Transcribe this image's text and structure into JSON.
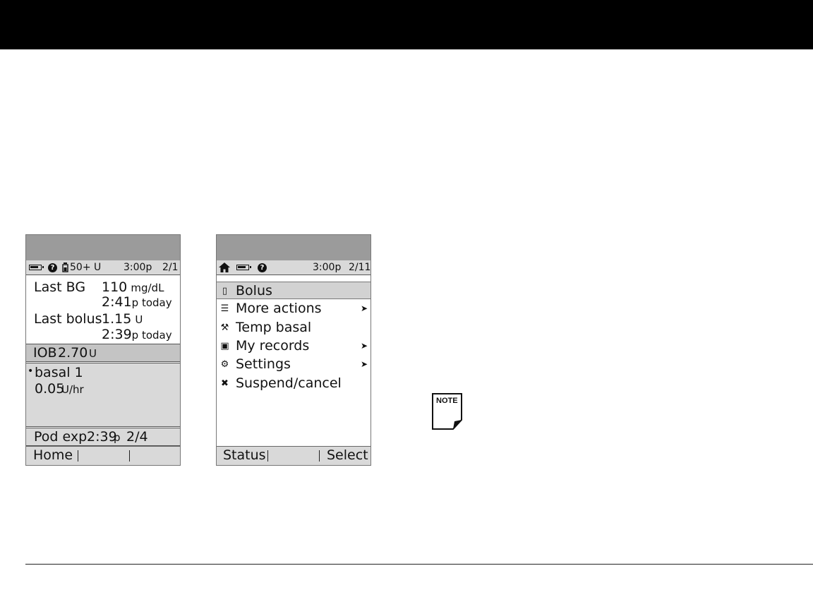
{
  "left_screen": {
    "status_bar": {
      "reservoir": "50+ U",
      "time": "3:00p",
      "date": "2/1"
    },
    "last_bg": {
      "label": "Last BG",
      "value": "110",
      "unit": "mg/dL",
      "time": "2:41",
      "time_suffix": "p today"
    },
    "last_bolus": {
      "label": "Last bolus",
      "value": "1.15",
      "unit": "U",
      "time": "2:39",
      "time_suffix": "p today"
    },
    "iob": {
      "label": "IOB",
      "value": "2.70",
      "unit": "U"
    },
    "basal": {
      "bullet": "•",
      "name": "basal 1",
      "rate": "0.05",
      "unit": "U/hr"
    },
    "pod_exp": {
      "label": "Pod exp",
      "time": "2:39",
      "suffix": "p",
      "date": "2/4"
    },
    "softkeys": {
      "left": "Home",
      "middle": "",
      "right": ""
    }
  },
  "right_screen": {
    "status_bar": {
      "time": "3:00p",
      "date": "2/11"
    },
    "menu": [
      {
        "label": "Bolus",
        "icon": "vial-icon",
        "glyph": "▯",
        "arrow": "",
        "selected": true
      },
      {
        "label": "More actions",
        "icon": "list-icon",
        "glyph": "☰",
        "arrow": "➤",
        "selected": false
      },
      {
        "label": "Temp basal",
        "icon": "tools-icon",
        "glyph": "⚒",
        "arrow": "",
        "selected": false
      },
      {
        "label": "My records",
        "icon": "records-icon",
        "glyph": "▣",
        "arrow": "➤",
        "selected": false
      },
      {
        "label": "Settings",
        "icon": "settings-icon",
        "glyph": "⚙",
        "arrow": "➤",
        "selected": false
      },
      {
        "label": "Suspend/cancel",
        "icon": "cancel-icon",
        "glyph": "✖",
        "arrow": "",
        "selected": false
      }
    ],
    "softkeys": {
      "left": "Status",
      "middle": "",
      "right": "Select"
    }
  },
  "note_icon": {
    "label": "NOTE"
  }
}
